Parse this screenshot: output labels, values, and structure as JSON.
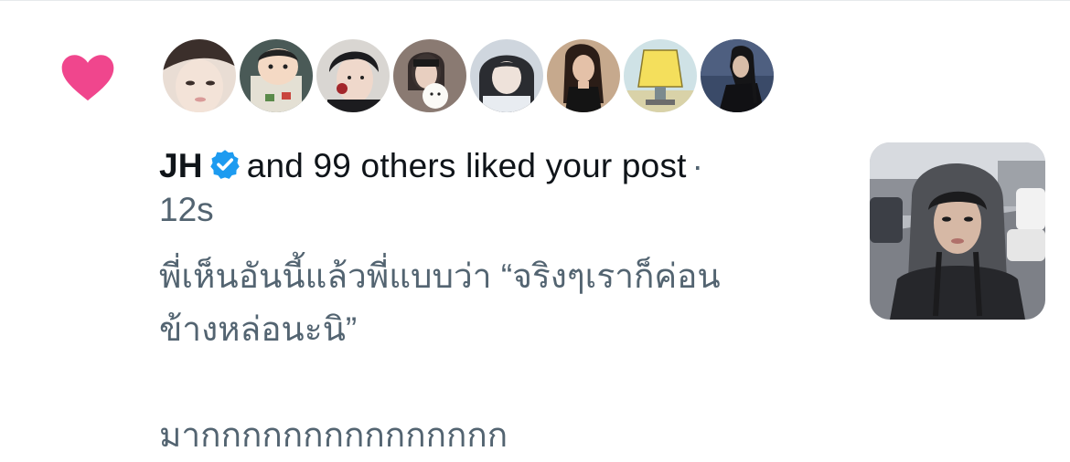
{
  "notification": {
    "icon": "heart-icon",
    "icon_color": "#f0468d",
    "actor_name": "JH",
    "verified_icon": "verified-badge-icon",
    "verified_color": "#1d9bf0",
    "action_text": "and 99 others liked your post",
    "separator": "·",
    "time": "12s",
    "post_text": "พี่เห็นอันนี้แล้วพี่แบบว่า “จริงๆเราก็ค่อน\nข้างหล่อนะนิ”\n\nมากกกกกกกกกกกกกกก",
    "avatars": [
      {
        "name": "avatar-1"
      },
      {
        "name": "avatar-2"
      },
      {
        "name": "avatar-3"
      },
      {
        "name": "avatar-4"
      },
      {
        "name": "avatar-5"
      },
      {
        "name": "avatar-6"
      },
      {
        "name": "avatar-7"
      },
      {
        "name": "avatar-8"
      }
    ]
  },
  "colors": {
    "text_primary": "#0f1419",
    "text_secondary": "#536471"
  }
}
